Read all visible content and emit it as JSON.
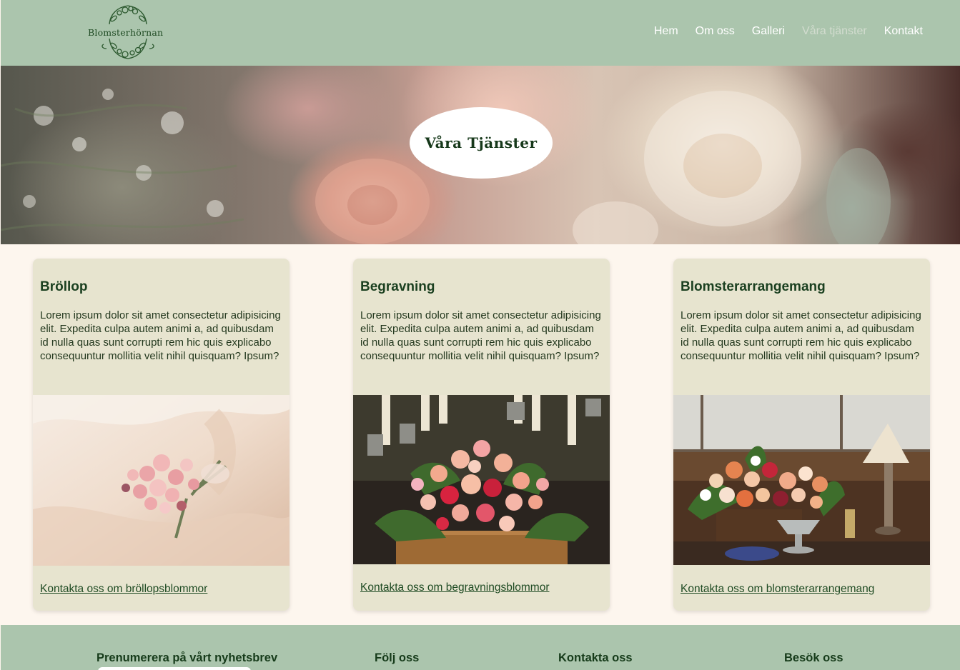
{
  "header": {
    "logo_text": "Blomsterhörnan",
    "nav": [
      {
        "label": "Hem"
      },
      {
        "label": "Om oss"
      },
      {
        "label": "Galleri"
      },
      {
        "label": "Våra tjänster",
        "active": true
      },
      {
        "label": "Kontakt"
      }
    ]
  },
  "hero": {
    "title": "Våra Tjänster"
  },
  "cards": [
    {
      "title": "Bröllop",
      "text": "Lorem ipsum dolor sit amet consectetur adipisicing elit. Expedita culpa autem animi a, ad quibusdam id nulla quas sunt corrupti rem hic quis explicabo consequuntur mollitia velit nihil quisquam? Ipsum?",
      "link": "Kontakta oss om bröllopsblommor"
    },
    {
      "title": "Begravning",
      "text": "Lorem ipsum dolor sit amet consectetur adipisicing elit. Expedita culpa autem animi a, ad quibusdam id nulla quas sunt corrupti rem hic quis explicabo consequuntur mollitia velit nihil quisquam? Ipsum?",
      "link": "Kontakta oss om begravningsblommor"
    },
    {
      "title": "Blomsterarrangemang",
      "text": "Lorem ipsum dolor sit amet consectetur adipisicing elit. Expedita culpa autem animi a, ad quibusdam id nulla quas sunt corrupti rem hic quis explicabo consequuntur mollitia velit nihil quisquam? Ipsum?",
      "link": "Kontakta oss om blomsterarrangemang"
    }
  ],
  "footer": {
    "newsletter": "Prenumerera på vårt nyhetsbrev",
    "follow": "Följ oss",
    "contact": "Kontakta oss",
    "visit": "Besök oss"
  },
  "colors": {
    "header_bg": "#abc5ad",
    "page_bg": "#fdf6ee",
    "card_bg": "#e7e4cf",
    "text_dark_green": "#1b4020"
  }
}
